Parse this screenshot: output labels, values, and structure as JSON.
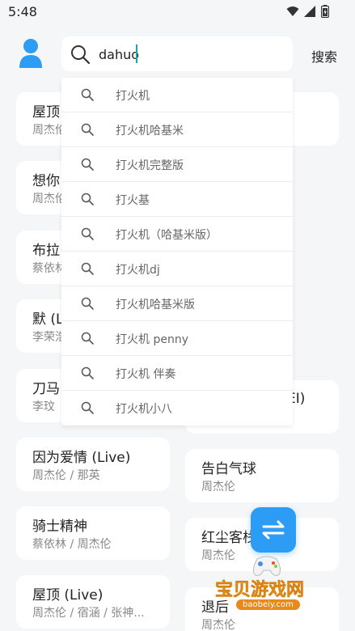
{
  "status_bar": {
    "time": "5:48"
  },
  "search": {
    "value": "dahuo",
    "submit_label": "搜索"
  },
  "suggestions": [
    "打火机",
    "打火机哈基米",
    "打火机完整版",
    "打火基",
    "打火机（哈基米版）",
    "打火机dj",
    "打火机哈基米版",
    "打火机 penny",
    "打火机 伴奏",
    "打火机小八"
  ],
  "left_cards": [
    {
      "title": "屋顶",
      "artist": "周杰伦"
    },
    {
      "title": "想你",
      "artist": "周杰伦"
    },
    {
      "title": "布拉",
      "artist": "蔡依林"
    },
    {
      "title": "默 (L",
      "artist": "李荣浩"
    },
    {
      "title": "刀马",
      "artist": "李玟"
    },
    {
      "title": "因为爱情 (Live)",
      "artist": "周杰伦 / 那英"
    },
    {
      "title": "骑士精神",
      "artist": "蔡依林 / 周杰伦"
    },
    {
      "title": "屋顶 (Live)",
      "artist": "周杰伦 / 宿涵 / 张神..."
    }
  ],
  "right_cards": [
    {
      "title": "EI)",
      "artist": ""
    },
    {
      "title": "告白气球",
      "artist": "周杰伦"
    },
    {
      "title": "红尘客栈",
      "artist": "周杰伦"
    },
    {
      "title": "退后",
      "artist": "周杰伦"
    }
  ],
  "watermark": {
    "title": "宝贝游戏网",
    "url": "baobeiy.com"
  },
  "colors": {
    "accent": "#2d9cf4",
    "caret": "#1aa7a3",
    "watermark": "#f5a623"
  }
}
